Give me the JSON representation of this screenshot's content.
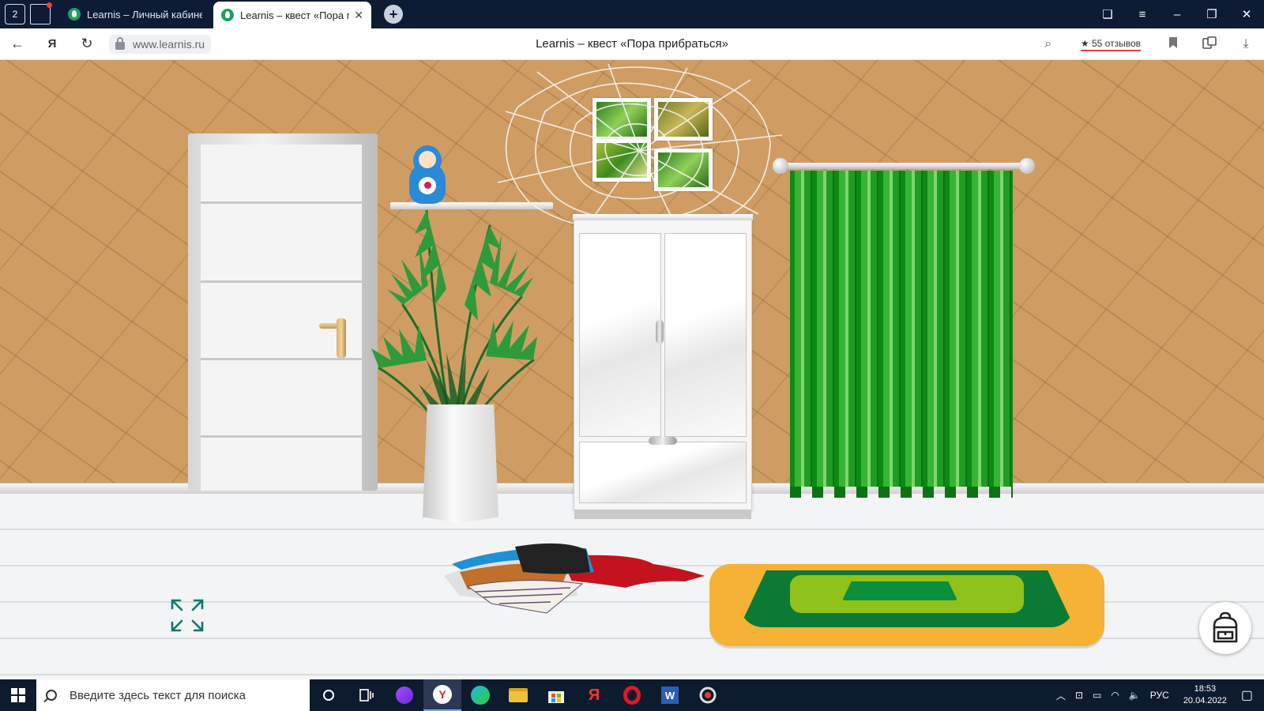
{
  "browser": {
    "tab_count": "2",
    "tabs": [
      {
        "label": "Learnis – Личный кабинет",
        "active": false
      },
      {
        "label": "Learnis – квест «Пора прибраться»",
        "active": true
      }
    ],
    "new_tab": "+",
    "window_controls": {
      "minimize": "–",
      "restore": "❐",
      "close": "✕",
      "collections": "❏",
      "menu": "≡"
    }
  },
  "addressbar": {
    "back": "←",
    "ya": "Я",
    "reload": "↻",
    "url": "www.learnis.ru",
    "page_title": "Learnis – квест «Пора прибраться»",
    "reviews": "★ 55 отзывов",
    "search_icon": "⌕",
    "bookmark_icon": "🔖",
    "download_icon": "⤓"
  },
  "scene": {
    "name": "Пора прибраться",
    "objects": [
      "door",
      "matryoshka-doll",
      "shelf",
      "cobweb",
      "pictures",
      "wardrobe",
      "curtain",
      "potted-palm",
      "clothes-pile",
      "rug"
    ],
    "colors": {
      "wall": "#cf9d63",
      "floor": "#f3f4f5",
      "curtain": "#1f9c22",
      "rug_outer": "#f5b234"
    }
  },
  "taskbar": {
    "search_placeholder": "Введите здесь текст для поиска",
    "apps": [
      "cortana",
      "task-view",
      "alice",
      "yandex-browser",
      "edge",
      "explorer",
      "store",
      "yandex",
      "opera",
      "word",
      "app"
    ],
    "lang": "РУС",
    "time": "18:53",
    "date": "20.04.2022"
  }
}
